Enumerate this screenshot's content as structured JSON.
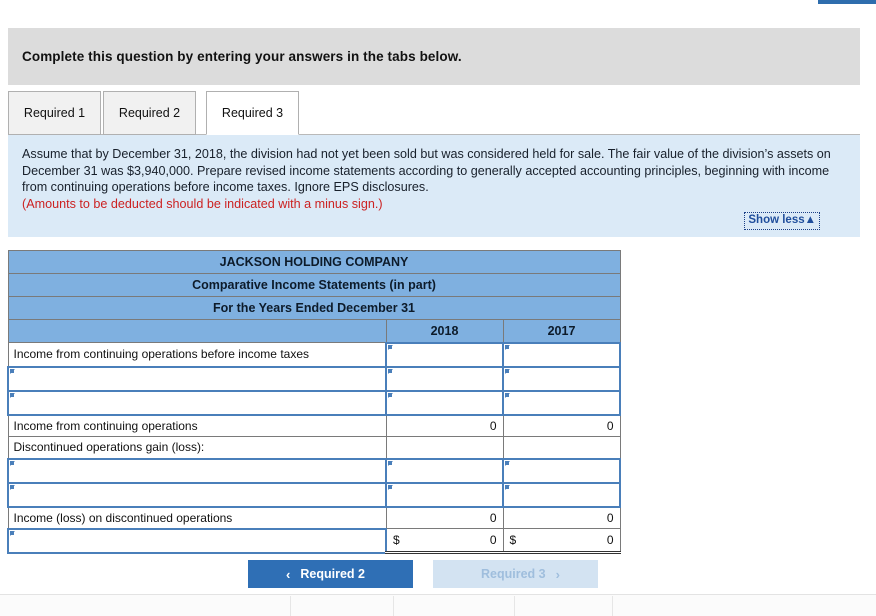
{
  "banner": {
    "text": "Complete this question by entering your answers in the tabs below."
  },
  "tabs": [
    {
      "label": "Required 1",
      "active": false
    },
    {
      "label": "Required 2",
      "active": false
    },
    {
      "label": "Required 3",
      "active": true
    }
  ],
  "instructions": {
    "body": "Assume that by December 31, 2018, the division had not yet been sold but was considered held for sale. The fair value of the division’s assets on December 31 was $3,940,000. Prepare revised income statements according to generally accepted accounting principles, beginning with income from continuing operations before income taxes. Ignore EPS disclosures.",
    "warning": "(Amounts to be deducted should be indicated with a minus sign.)",
    "show_less_label": "Show less▲"
  },
  "statement": {
    "title_lines": [
      "JACKSON HOLDING COMPANY",
      "Comparative Income Statements (in part)",
      "For the Years Ended December 31"
    ],
    "column_headers": [
      "",
      "2018",
      "2017"
    ],
    "rows": [
      {
        "label": "Income from continuing operations before income taxes",
        "label_edit": false,
        "y2018": "",
        "y2017": "",
        "edit": true,
        "dollar": false,
        "total": false
      },
      {
        "label": "",
        "label_edit": true,
        "y2018": "",
        "y2017": "",
        "edit": true,
        "dollar": false,
        "total": false
      },
      {
        "label": "",
        "label_edit": true,
        "y2018": "",
        "y2017": "",
        "edit": true,
        "dollar": false,
        "total": false
      },
      {
        "label": "Income from continuing operations",
        "label_edit": false,
        "y2018": "0",
        "y2017": "0",
        "edit": false,
        "dollar": false,
        "total": false
      },
      {
        "label": "Discontinued operations gain (loss):",
        "label_edit": false,
        "y2018": "",
        "y2017": "",
        "edit": false,
        "dollar": false,
        "total": false
      },
      {
        "label": "",
        "label_edit": true,
        "y2018": "",
        "y2017": "",
        "edit": true,
        "dollar": false,
        "total": false
      },
      {
        "label": "",
        "label_edit": true,
        "y2018": "",
        "y2017": "",
        "edit": true,
        "dollar": false,
        "total": false
      },
      {
        "label": "Income (loss) on discontinued operations",
        "label_edit": false,
        "y2018": "0",
        "y2017": "0",
        "edit": false,
        "dollar": false,
        "total": false
      },
      {
        "label": "",
        "label_edit": true,
        "y2018": "0",
        "y2017": "0",
        "edit": false,
        "dollar": true,
        "total": true,
        "currency_symbol": "$"
      }
    ]
  },
  "navigation": {
    "prev_label": "Required 2",
    "prev_icon": "chevron-left-icon",
    "prev_chevron": "‹",
    "next_label": "Required 3",
    "next_icon": "chevron-right-icon",
    "next_chevron": "›"
  },
  "colors": {
    "table_header_blue": "#7fb0e0",
    "instruction_bg": "#dbeaf7",
    "banner_bg": "#dcdcdc",
    "primary_button": "#2f6fb5",
    "disabled_button": "#d3e3f2",
    "warning_text": "#cc2222",
    "input_border": "#4a7fba"
  }
}
